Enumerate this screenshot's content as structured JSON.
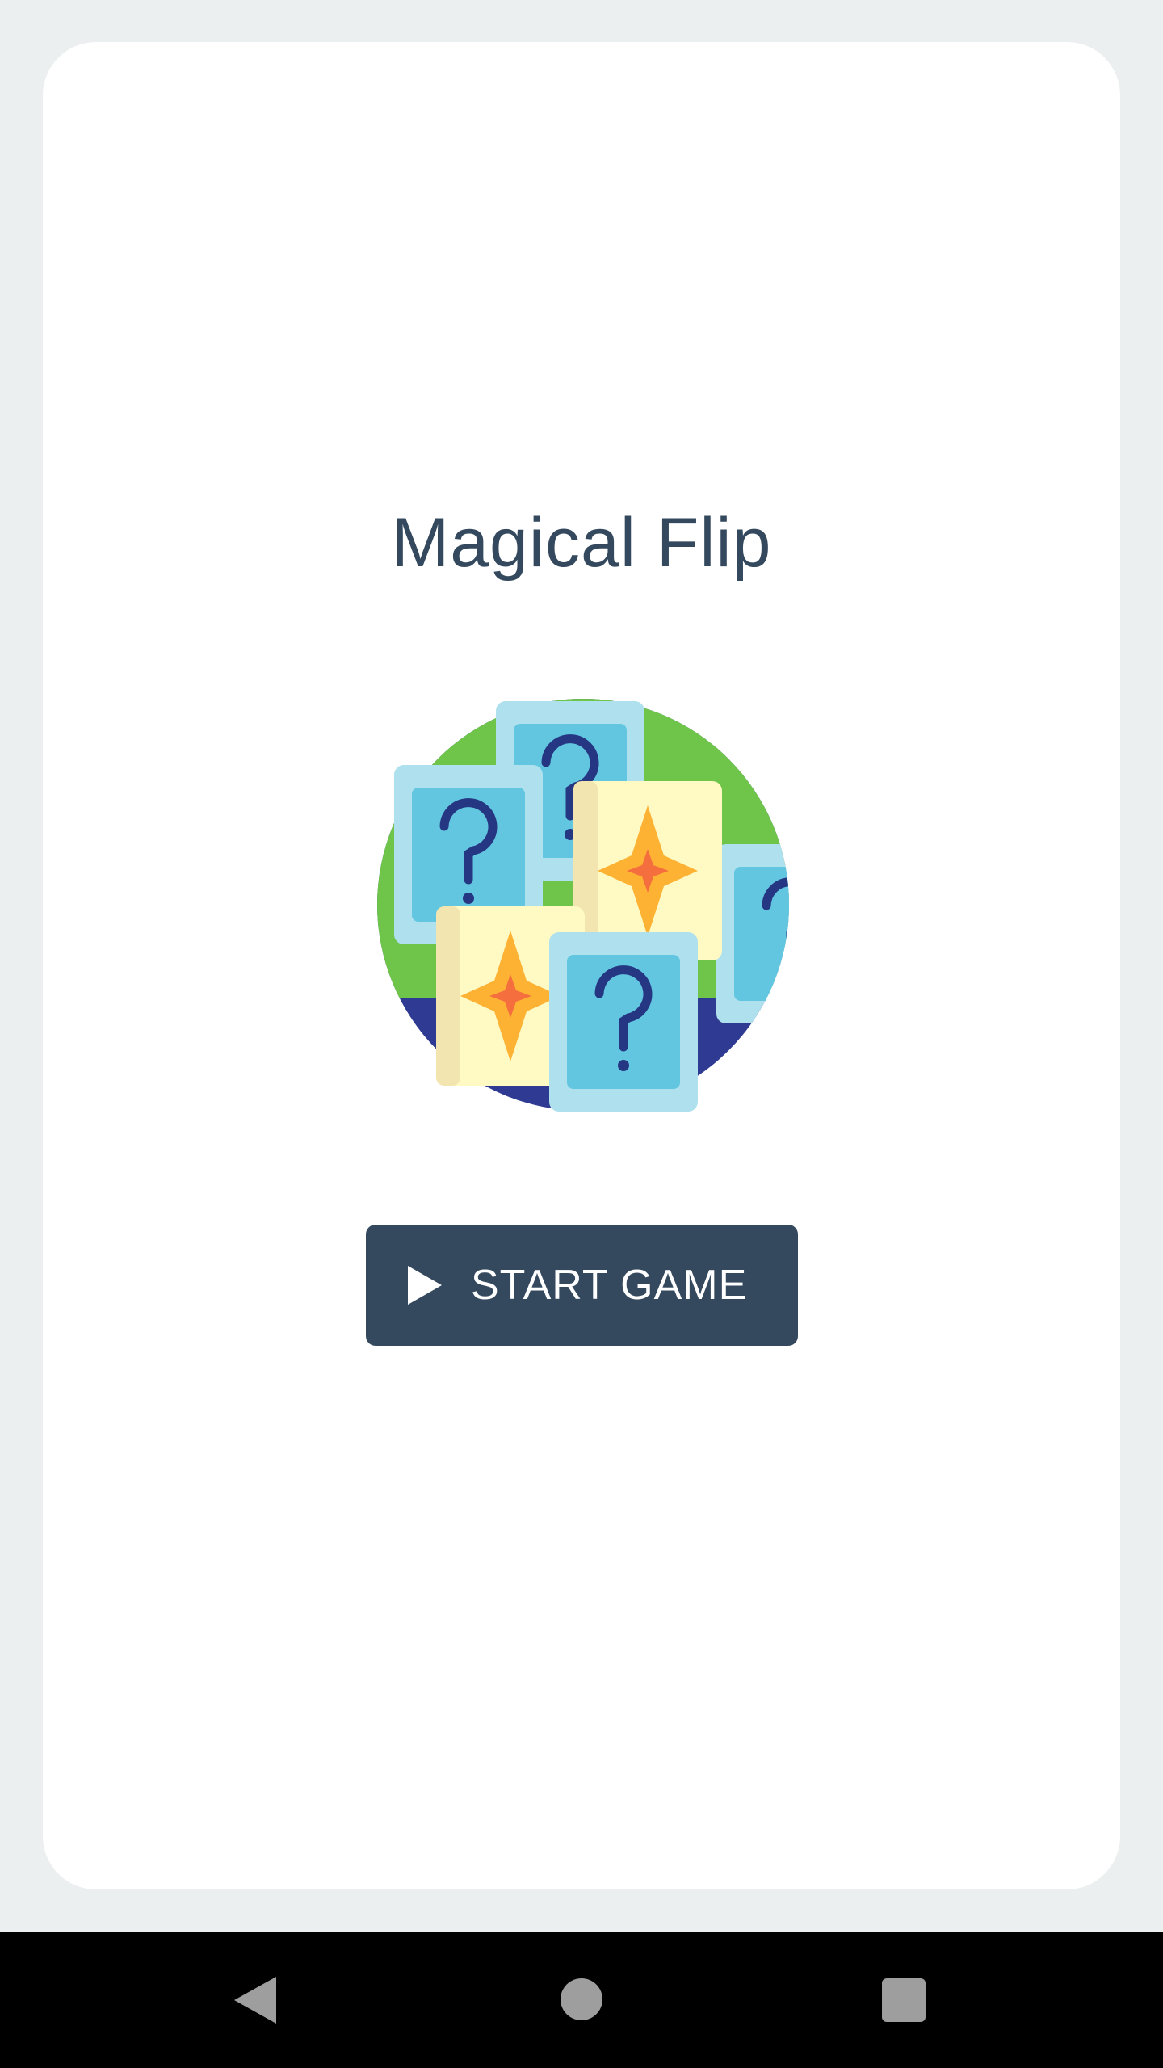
{
  "app": {
    "title": "Magical Flip"
  },
  "start_button": {
    "label": "START GAME",
    "icon": "play-icon"
  },
  "illustration": {
    "icon": "cards-illustration-icon",
    "colors": {
      "circle_top": "#6ec54a",
      "circle_bottom": "#2f3a93",
      "card_blue": "#62c6e0",
      "card_blue_frame": "#aee0ee",
      "card_yellow": "#fff9c4",
      "card_yellow_edge": "#f3e5b0",
      "star_outer": "#fdb234",
      "star_inner": "#f46f3d",
      "question_mark": "#253682"
    }
  },
  "navigation_bar": {
    "back": "back-icon",
    "home": "home-icon",
    "recents": "recents-icon"
  },
  "colors": {
    "page_background": "#eceff0",
    "card_background": "#ffffff",
    "title": "#34495e",
    "button": "#34495e",
    "navbar": "#000000",
    "nav_icons": "#9e9e9e"
  }
}
